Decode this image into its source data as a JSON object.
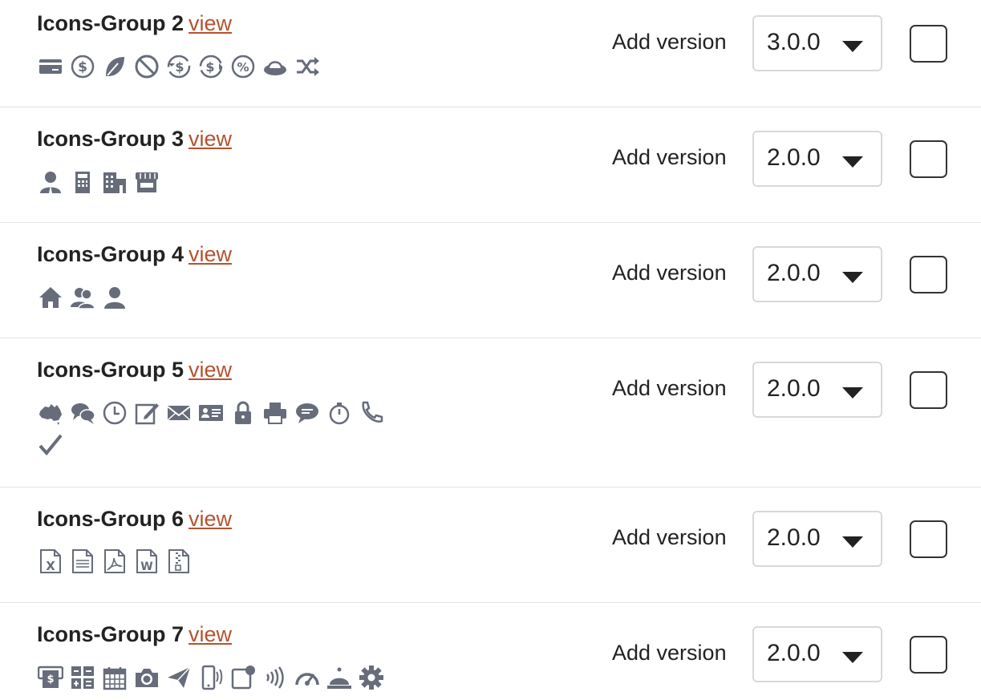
{
  "add_label": "Add version",
  "view_label": "view",
  "groups": [
    {
      "title": "Icons-Group 2",
      "version": "3.0.0",
      "icons": [
        "credit-card-icon",
        "dollar-coin-icon",
        "leaf-icon",
        "ban-icon",
        "dollar-refresh-icon",
        "dollar-arrows-icon",
        "percent-icon",
        "piggy-bank-icon",
        "shuffle-icon"
      ]
    },
    {
      "title": "Icons-Group 3",
      "version": "2.0.0",
      "icons": [
        "business-person-icon",
        "calculator-building-icon",
        "office-building-icon",
        "storefront-icon"
      ]
    },
    {
      "title": "Icons-Group 4",
      "version": "2.0.0",
      "icons": [
        "home-icon",
        "users-icon",
        "user-icon"
      ]
    },
    {
      "title": "Icons-Group 5",
      "version": "2.0.0",
      "icons": [
        "australia-map-icon",
        "chat-bubbles-icon",
        "clock-icon",
        "edit-note-icon",
        "envelope-icon",
        "id-card-icon",
        "lock-icon",
        "printer-icon",
        "speech-bubble-icon",
        "stopwatch-icon",
        "phone-icon",
        "checkmark-icon"
      ]
    },
    {
      "title": "Icons-Group 6",
      "version": "2.0.0",
      "icons": [
        "excel-file-icon",
        "text-file-icon",
        "pdf-file-icon",
        "word-file-icon",
        "zip-file-icon"
      ]
    },
    {
      "title": "Icons-Group 7",
      "version": "2.0.0",
      "icons": [
        "atm-icon",
        "calculator-icon",
        "calendar-icon",
        "camera-icon",
        "paper-plane-icon",
        "mobile-vibrate-icon",
        "notification-icon",
        "contactless-icon",
        "speedometer-icon",
        "service-bell-icon",
        "gear-icon"
      ]
    }
  ],
  "colors": {
    "icon": "#666c7a",
    "link": "#b4532f",
    "separator": "#e2e2e2"
  }
}
